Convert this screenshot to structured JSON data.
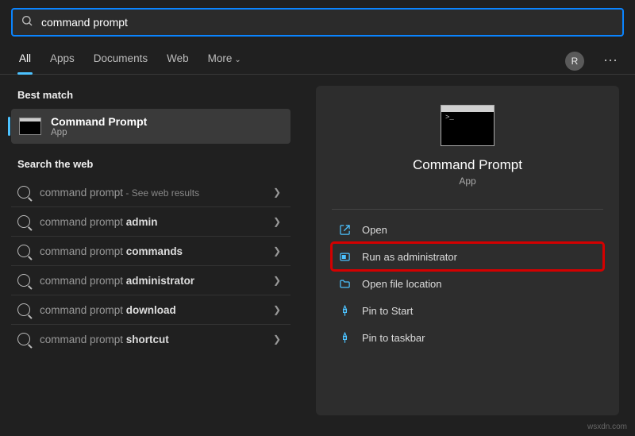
{
  "search": {
    "query": "command prompt"
  },
  "tabs": {
    "items": [
      "All",
      "Apps",
      "Documents",
      "Web",
      "More"
    ],
    "active_index": 0,
    "user_initial": "R"
  },
  "left": {
    "best_match_label": "Best match",
    "best_match": {
      "title": "Command Prompt",
      "subtitle": "App"
    },
    "search_web_label": "Search the web",
    "web_results": [
      {
        "prefix": "command prompt",
        "bold": "",
        "hint": " - See web results"
      },
      {
        "prefix": "command prompt ",
        "bold": "admin",
        "hint": ""
      },
      {
        "prefix": "command prompt ",
        "bold": "commands",
        "hint": ""
      },
      {
        "prefix": "command prompt ",
        "bold": "administrator",
        "hint": ""
      },
      {
        "prefix": "command prompt ",
        "bold": "download",
        "hint": ""
      },
      {
        "prefix": "command prompt ",
        "bold": "shortcut",
        "hint": ""
      }
    ]
  },
  "right": {
    "title": "Command Prompt",
    "subtitle": "App",
    "actions": [
      {
        "icon": "open-icon",
        "label": "Open",
        "highlight": false
      },
      {
        "icon": "shield-icon",
        "label": "Run as administrator",
        "highlight": true
      },
      {
        "icon": "folder-icon",
        "label": "Open file location",
        "highlight": false
      },
      {
        "icon": "pin-icon",
        "label": "Pin to Start",
        "highlight": false
      },
      {
        "icon": "pin-icon",
        "label": "Pin to taskbar",
        "highlight": false
      }
    ]
  },
  "watermark": "wsxdn.com"
}
